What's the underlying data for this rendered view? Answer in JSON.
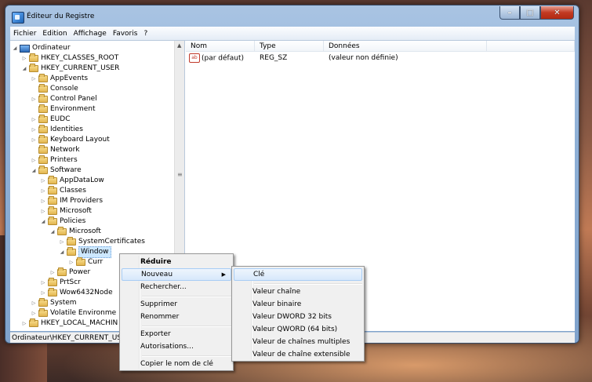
{
  "window": {
    "title": "Éditeur du Registre",
    "controls": {
      "minimize": "–",
      "maximize": "□",
      "close": "✕"
    }
  },
  "menubar": {
    "items": [
      "Fichier",
      "Edition",
      "Affichage",
      "Favoris",
      "?"
    ]
  },
  "tree": {
    "root": "Ordinateur",
    "nodes": [
      "HKEY_CLASSES_ROOT",
      "HKEY_CURRENT_USER",
      "AppEvents",
      "Console",
      "Control Panel",
      "Environment",
      "EUDC",
      "Identities",
      "Keyboard Layout",
      "Network",
      "Printers",
      "Software",
      "AppDataLow",
      "Classes",
      "IM Providers",
      "Microsoft",
      "Policies",
      "Microsoft",
      "SystemCertificates",
      "Window",
      "Curr",
      "Power",
      "PrtScr",
      "Wow6432Node",
      "System",
      "Volatile Environme",
      "HKEY_LOCAL_MACHIN"
    ]
  },
  "list": {
    "columns": [
      "Nom",
      "Type",
      "Données"
    ],
    "rows": [
      {
        "name": "(par défaut)",
        "type": "REG_SZ",
        "data": "(valeur non définie)"
      }
    ]
  },
  "status": "Ordinateur\\HKEY_CURRENT_USER",
  "context_menu": {
    "items": [
      "Réduire",
      "Nouveau",
      "Rechercher...",
      "Supprimer",
      "Renommer",
      "Exporter",
      "Autorisations...",
      "Copier le nom de clé"
    ]
  },
  "submenu": {
    "items": [
      "Clé",
      "Valeur chaîne",
      "Valeur binaire",
      "Valeur DWORD 32 bits",
      "Valeur QWORD (64 bits)",
      "Valeur de chaînes multiples",
      "Valeur de chaîne extensible"
    ]
  },
  "colors": {
    "highlight": "#cde8ff",
    "menu_hover": "#d7e8fb",
    "title_bar": "#8fb0d6"
  }
}
